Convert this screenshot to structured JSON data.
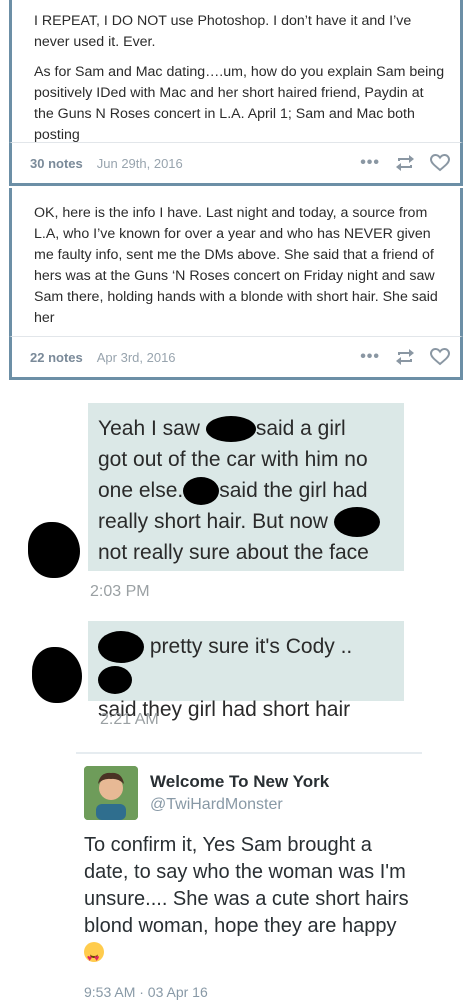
{
  "posts": [
    {
      "paragraphs": [
        "I REPEAT, I DO NOT use Photoshop. I don’t have it and I’ve never used it. Ever.",
        "As for Sam and Mac dating….um, how do you explain Sam being positively IDed with Mac and her short haired friend, Paydin at the Guns N Roses concert in L.A. April 1; Sam and Mac both posting"
      ],
      "notes": "30 notes",
      "date": "Jun 29th, 2016"
    },
    {
      "paragraphs": [
        "OK, here is the info I have. Last night and today, a source from L.A, who I’ve known for over a year and who has NEVER given me faulty info, sent me the DMs above. She said that a friend of hers was at the Guns ‘N Roses concert on Friday night and saw Sam there, holding hands with a blonde with short hair. She said her"
      ],
      "notes": "22 notes",
      "date": "Apr 3rd, 2016"
    }
  ],
  "dm": {
    "message1": {
      "part1": "Yeah I saw",
      "part2": "said a girl",
      "part3": "got out of the car with him no",
      "part4": "one else.",
      "part5": "said the girl had",
      "part6": "really short hair. But now",
      "part7": "not really sure about the face",
      "time": "2:03 PM"
    },
    "message2": {
      "part1": "pretty sure it's Cody ..",
      "part2": "said they girl had short hair",
      "time": "2:21 AM"
    }
  },
  "tweet": {
    "name": "Welcome To New York",
    "handle": "@TwiHardMonster",
    "text": "To confirm it, Yes Sam brought a date, to say who the woman was I'm unsure.... She was a cute short hairs blond woman, hope they are happy",
    "meta": "9:53 AM · 03 Apr 16"
  },
  "colors": {
    "post_border": "#6c8fa6",
    "bubble_bg": "#dbe8e7",
    "redaction": "#000000"
  },
  "icons": [
    "more-dots-icon",
    "reblog-icon",
    "heart-icon",
    "emoji-heart-eyes-icon"
  ]
}
